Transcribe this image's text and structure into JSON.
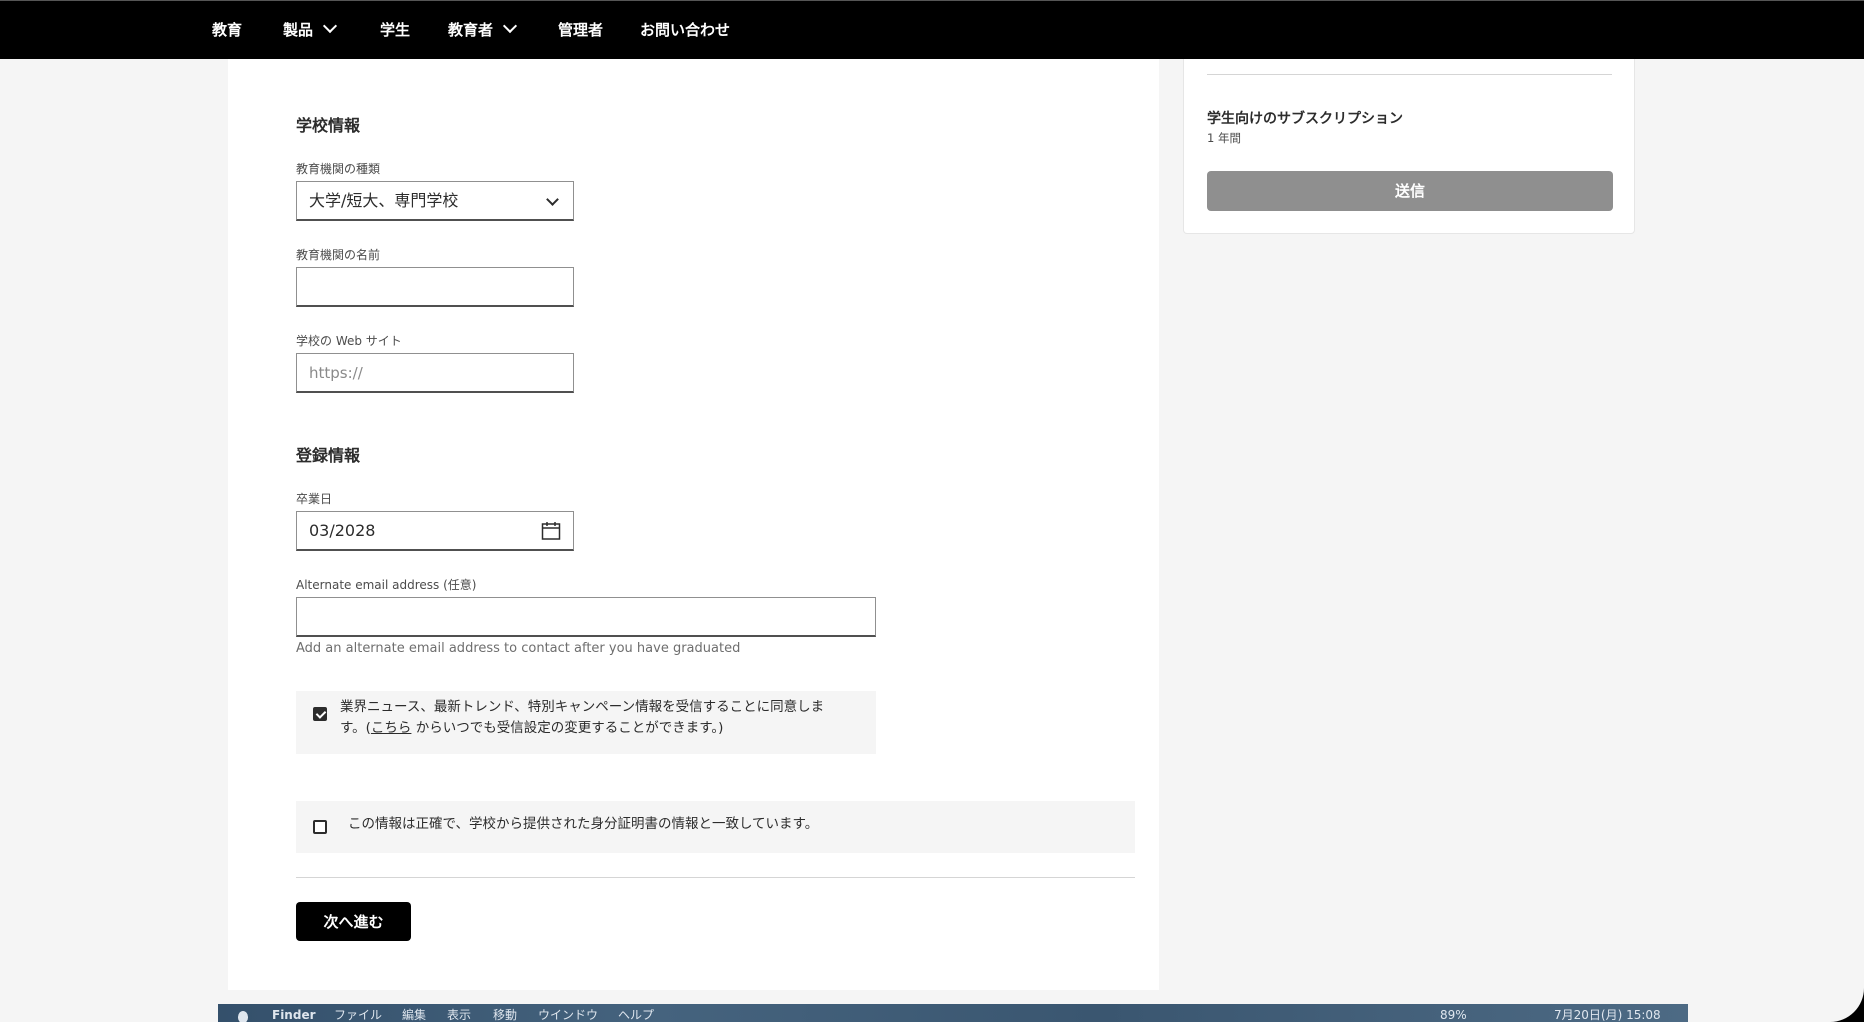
{
  "nav": {
    "items": [
      {
        "label": "教育",
        "has_menu": false
      },
      {
        "label": "製品",
        "has_menu": true
      },
      {
        "label": "学生",
        "has_menu": false
      },
      {
        "label": "教育者",
        "has_menu": true
      },
      {
        "label": "管理者",
        "has_menu": false
      },
      {
        "label": "お問い合わせ",
        "has_menu": false
      }
    ]
  },
  "school": {
    "title": "学校情報",
    "type_label": "教育機関の種類",
    "type_value": "大学/短大、専門学校",
    "name_label": "教育機関の名前",
    "name_value": "",
    "website_label": "学校の Web サイト",
    "website_placeholder": "https://"
  },
  "registration": {
    "title": "登録情報",
    "grad_label": "卒業日",
    "grad_value": "03/2028",
    "alt_email_label": "Alternate email address (任意)",
    "alt_email_value": "",
    "alt_email_help": "Add an alternate email address to contact after you have graduated"
  },
  "marketing_consent": {
    "checked": true,
    "line1": "業界ニュース、最新トレンド、特別キャンペーン情報を受信することに同意しま",
    "line2_prefix": "す。(",
    "link": "こちら",
    "line2_suffix": " からいつでも受信設定の変更することができます。)"
  },
  "accuracy_consent": {
    "checked": false,
    "text": "この情報は正確で、学校から提供された身分証明書の情報と一致しています。"
  },
  "next_button": "次へ進む",
  "summary": {
    "title": "学生向けのサブスクリプション",
    "term": "1 年間",
    "submit": "送信"
  },
  "mac_menu": {
    "app": "Finder",
    "items": [
      "ファイル",
      "編集",
      "表示",
      "移動",
      "ウインドウ",
      "ヘルプ"
    ],
    "battery": "89%",
    "clock": "7月20日(月) 15:08"
  },
  "colors": {
    "nav_bg": "#000000",
    "primary_button": "#000000",
    "submit_disabled": "#8f8f8f",
    "page_bg": "#f5f5f5"
  }
}
